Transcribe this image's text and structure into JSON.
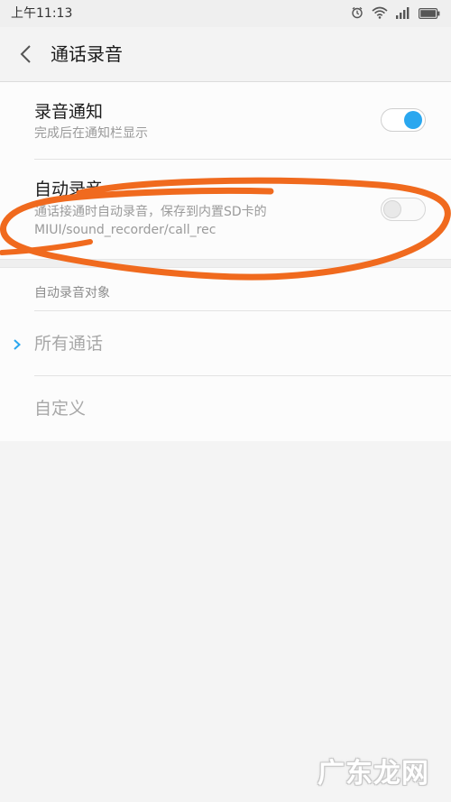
{
  "status_bar": {
    "time": "上午11:13",
    "icons": [
      "alarm-icon",
      "wifi-icon",
      "signal-icon",
      "battery-icon"
    ]
  },
  "header": {
    "back_icon": "back-chevron-icon",
    "title": "通话录音"
  },
  "settings": {
    "notify": {
      "title": "录音通知",
      "subtitle": "完成后在通知栏显示",
      "enabled": true
    },
    "auto_record": {
      "title": "自动录音",
      "subtitle": "通话接通时自动录音，保存到内置SD卡的MIUI/sound_recorder/call_rec",
      "enabled": false
    }
  },
  "auto_target": {
    "label": "自动录音对象",
    "options": [
      {
        "label": "所有通话",
        "selected": true
      },
      {
        "label": "自定义",
        "selected": false
      }
    ]
  },
  "watermark": "广东龙网",
  "colors": {
    "accent": "#2aa7ef",
    "annotation": "#f06a1e",
    "background": "#f4f4f4"
  }
}
